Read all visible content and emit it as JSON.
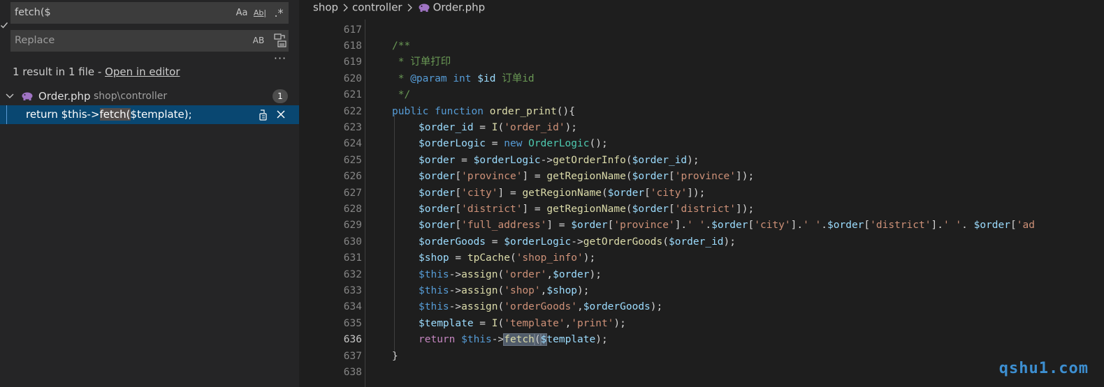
{
  "search": {
    "find_value": "fetch($",
    "replace_placeholder": "Replace",
    "options": {
      "match_case": "Aa",
      "whole_word": "Ab|",
      "regex": ".*",
      "preserve_case": "AB"
    },
    "more_label": "···",
    "summary_text": "1 result in 1 file - ",
    "open_in_editor": "Open in editor",
    "results": [
      {
        "file_name": "Order.php",
        "file_path": "shop\\controller",
        "count": "1",
        "matches": [
          {
            "before": "return $this->",
            "match": "fetch(",
            "after": "$template);"
          }
        ]
      }
    ]
  },
  "editor": {
    "breadcrumb": [
      "shop",
      "controller",
      "Order.php"
    ],
    "lines": [
      {
        "n": "617",
        "indent": 0,
        "tokens": []
      },
      {
        "n": "618",
        "indent": 1,
        "tokens": [
          {
            "t": "/**",
            "c": "comment"
          }
        ]
      },
      {
        "n": "619",
        "indent": 1,
        "tokens": [
          {
            "t": " * 订单打印",
            "c": "comment"
          }
        ]
      },
      {
        "n": "620",
        "indent": 1,
        "tokens": [
          {
            "t": " * ",
            "c": "comment"
          },
          {
            "t": "@param",
            "c": "doc"
          },
          {
            "t": " ",
            "c": "comment"
          },
          {
            "t": "int",
            "c": "doc"
          },
          {
            "t": " ",
            "c": "comment"
          },
          {
            "t": "$id",
            "c": "var"
          },
          {
            "t": " 订单id",
            "c": "comment"
          }
        ]
      },
      {
        "n": "621",
        "indent": 1,
        "tokens": [
          {
            "t": " */",
            "c": "comment"
          }
        ]
      },
      {
        "n": "622",
        "indent": 1,
        "tokens": [
          {
            "t": "public",
            "c": "kw"
          },
          {
            "t": " ",
            "c": "punc"
          },
          {
            "t": "function",
            "c": "kw"
          },
          {
            "t": " ",
            "c": "punc"
          },
          {
            "t": "order_print",
            "c": "fn"
          },
          {
            "t": "(){",
            "c": "punc"
          }
        ]
      },
      {
        "n": "623",
        "indent": 2,
        "tokens": [
          {
            "t": "$order_id",
            "c": "var"
          },
          {
            "t": " = ",
            "c": "punc"
          },
          {
            "t": "I",
            "c": "fn"
          },
          {
            "t": "(",
            "c": "punc"
          },
          {
            "t": "'order_id'",
            "c": "str"
          },
          {
            "t": ");",
            "c": "punc"
          }
        ]
      },
      {
        "n": "624",
        "indent": 2,
        "tokens": [
          {
            "t": "$orderLogic",
            "c": "var"
          },
          {
            "t": " = ",
            "c": "punc"
          },
          {
            "t": "new",
            "c": "kw"
          },
          {
            "t": " ",
            "c": "punc"
          },
          {
            "t": "OrderLogic",
            "c": "cls"
          },
          {
            "t": "();",
            "c": "punc"
          }
        ]
      },
      {
        "n": "625",
        "indent": 2,
        "tokens": [
          {
            "t": "$order",
            "c": "var"
          },
          {
            "t": " = ",
            "c": "punc"
          },
          {
            "t": "$orderLogic",
            "c": "var"
          },
          {
            "t": "->",
            "c": "punc"
          },
          {
            "t": "getOrderInfo",
            "c": "fn"
          },
          {
            "t": "(",
            "c": "punc"
          },
          {
            "t": "$order_id",
            "c": "var"
          },
          {
            "t": ");",
            "c": "punc"
          }
        ]
      },
      {
        "n": "626",
        "indent": 2,
        "tokens": [
          {
            "t": "$order",
            "c": "var"
          },
          {
            "t": "[",
            "c": "punc"
          },
          {
            "t": "'province'",
            "c": "str"
          },
          {
            "t": "] = ",
            "c": "punc"
          },
          {
            "t": "getRegionName",
            "c": "fn"
          },
          {
            "t": "(",
            "c": "punc"
          },
          {
            "t": "$order",
            "c": "var"
          },
          {
            "t": "[",
            "c": "punc"
          },
          {
            "t": "'province'",
            "c": "str"
          },
          {
            "t": "]);",
            "c": "punc"
          }
        ]
      },
      {
        "n": "627",
        "indent": 2,
        "tokens": [
          {
            "t": "$order",
            "c": "var"
          },
          {
            "t": "[",
            "c": "punc"
          },
          {
            "t": "'city'",
            "c": "str"
          },
          {
            "t": "] = ",
            "c": "punc"
          },
          {
            "t": "getRegionName",
            "c": "fn"
          },
          {
            "t": "(",
            "c": "punc"
          },
          {
            "t": "$order",
            "c": "var"
          },
          {
            "t": "[",
            "c": "punc"
          },
          {
            "t": "'city'",
            "c": "str"
          },
          {
            "t": "]);",
            "c": "punc"
          }
        ]
      },
      {
        "n": "628",
        "indent": 2,
        "tokens": [
          {
            "t": "$order",
            "c": "var"
          },
          {
            "t": "[",
            "c": "punc"
          },
          {
            "t": "'district'",
            "c": "str"
          },
          {
            "t": "] = ",
            "c": "punc"
          },
          {
            "t": "getRegionName",
            "c": "fn"
          },
          {
            "t": "(",
            "c": "punc"
          },
          {
            "t": "$order",
            "c": "var"
          },
          {
            "t": "[",
            "c": "punc"
          },
          {
            "t": "'district'",
            "c": "str"
          },
          {
            "t": "]);",
            "c": "punc"
          }
        ]
      },
      {
        "n": "629",
        "indent": 2,
        "tokens": [
          {
            "t": "$order",
            "c": "var"
          },
          {
            "t": "[",
            "c": "punc"
          },
          {
            "t": "'full_address'",
            "c": "str"
          },
          {
            "t": "] = ",
            "c": "punc"
          },
          {
            "t": "$order",
            "c": "var"
          },
          {
            "t": "[",
            "c": "punc"
          },
          {
            "t": "'province'",
            "c": "str"
          },
          {
            "t": "].",
            "c": "punc"
          },
          {
            "t": "' '",
            "c": "str"
          },
          {
            "t": ".",
            "c": "punc"
          },
          {
            "t": "$order",
            "c": "var"
          },
          {
            "t": "[",
            "c": "punc"
          },
          {
            "t": "'city'",
            "c": "str"
          },
          {
            "t": "].",
            "c": "punc"
          },
          {
            "t": "' '",
            "c": "str"
          },
          {
            "t": ".",
            "c": "punc"
          },
          {
            "t": "$order",
            "c": "var"
          },
          {
            "t": "[",
            "c": "punc"
          },
          {
            "t": "'district'",
            "c": "str"
          },
          {
            "t": "].",
            "c": "punc"
          },
          {
            "t": "' '",
            "c": "str"
          },
          {
            "t": ". ",
            "c": "punc"
          },
          {
            "t": "$order",
            "c": "var"
          },
          {
            "t": "[",
            "c": "punc"
          },
          {
            "t": "'ad",
            "c": "str"
          }
        ]
      },
      {
        "n": "630",
        "indent": 2,
        "tokens": [
          {
            "t": "$orderGoods",
            "c": "var"
          },
          {
            "t": " = ",
            "c": "punc"
          },
          {
            "t": "$orderLogic",
            "c": "var"
          },
          {
            "t": "->",
            "c": "punc"
          },
          {
            "t": "getOrderGoods",
            "c": "fn"
          },
          {
            "t": "(",
            "c": "punc"
          },
          {
            "t": "$order_id",
            "c": "var"
          },
          {
            "t": ");",
            "c": "punc"
          }
        ]
      },
      {
        "n": "631",
        "indent": 2,
        "tokens": [
          {
            "t": "$shop",
            "c": "var"
          },
          {
            "t": " = ",
            "c": "punc"
          },
          {
            "t": "tpCache",
            "c": "fn"
          },
          {
            "t": "(",
            "c": "punc"
          },
          {
            "t": "'shop_info'",
            "c": "str"
          },
          {
            "t": ");",
            "c": "punc"
          }
        ]
      },
      {
        "n": "632",
        "indent": 2,
        "tokens": [
          {
            "t": "$this",
            "c": "kw"
          },
          {
            "t": "->",
            "c": "punc"
          },
          {
            "t": "assign",
            "c": "fn"
          },
          {
            "t": "(",
            "c": "punc"
          },
          {
            "t": "'order'",
            "c": "str"
          },
          {
            "t": ",",
            "c": "punc"
          },
          {
            "t": "$order",
            "c": "var"
          },
          {
            "t": ");",
            "c": "punc"
          }
        ]
      },
      {
        "n": "633",
        "indent": 2,
        "tokens": [
          {
            "t": "$this",
            "c": "kw"
          },
          {
            "t": "->",
            "c": "punc"
          },
          {
            "t": "assign",
            "c": "fn"
          },
          {
            "t": "(",
            "c": "punc"
          },
          {
            "t": "'shop'",
            "c": "str"
          },
          {
            "t": ",",
            "c": "punc"
          },
          {
            "t": "$shop",
            "c": "var"
          },
          {
            "t": ");",
            "c": "punc"
          }
        ]
      },
      {
        "n": "634",
        "indent": 2,
        "tokens": [
          {
            "t": "$this",
            "c": "kw"
          },
          {
            "t": "->",
            "c": "punc"
          },
          {
            "t": "assign",
            "c": "fn"
          },
          {
            "t": "(",
            "c": "punc"
          },
          {
            "t": "'orderGoods'",
            "c": "str"
          },
          {
            "t": ",",
            "c": "punc"
          },
          {
            "t": "$orderGoods",
            "c": "var"
          },
          {
            "t": ");",
            "c": "punc"
          }
        ]
      },
      {
        "n": "635",
        "indent": 2,
        "tokens": [
          {
            "t": "$template",
            "c": "var"
          },
          {
            "t": " = ",
            "c": "punc"
          },
          {
            "t": "I",
            "c": "fn"
          },
          {
            "t": "(",
            "c": "punc"
          },
          {
            "t": "'template'",
            "c": "str"
          },
          {
            "t": ",",
            "c": "punc"
          },
          {
            "t": "'print'",
            "c": "str"
          },
          {
            "t": ");",
            "c": "punc"
          }
        ]
      },
      {
        "n": "636",
        "indent": 2,
        "current": true,
        "tokens": [
          {
            "t": "return",
            "c": "ctl"
          },
          {
            "t": " ",
            "c": "punc"
          },
          {
            "t": "$this",
            "c": "kw"
          },
          {
            "t": "->",
            "c": "punc"
          },
          {
            "t": "fetch",
            "c": "fn",
            "match": true
          },
          {
            "t": "(",
            "c": "punc",
            "match": true
          },
          {
            "t": "$",
            "c": "var",
            "match": true
          },
          {
            "t": "template",
            "c": "var"
          },
          {
            "t": ");",
            "c": "punc"
          }
        ]
      },
      {
        "n": "637",
        "indent": 1,
        "tokens": [
          {
            "t": "}",
            "c": "punc"
          }
        ]
      },
      {
        "n": "638",
        "indent": 0,
        "tokens": []
      }
    ]
  },
  "watermark": "qshu1.com",
  "colors": {
    "sidebar_bg": "#252526",
    "editor_bg": "#1e1e1e",
    "input_bg": "#3c3c3c",
    "selection_bg": "#094771",
    "php_icon": "#a074c4",
    "watermark": "#3d8fd1"
  },
  "icons": {
    "collapse": "check-icon",
    "expand": "chevron-down-icon",
    "file": "php-elephant-icon",
    "replace_all": "replace-all-icon",
    "replace": "replace-icon",
    "dismiss": "close-icon",
    "breadcrumb_sep": "chevron-right-icon"
  }
}
